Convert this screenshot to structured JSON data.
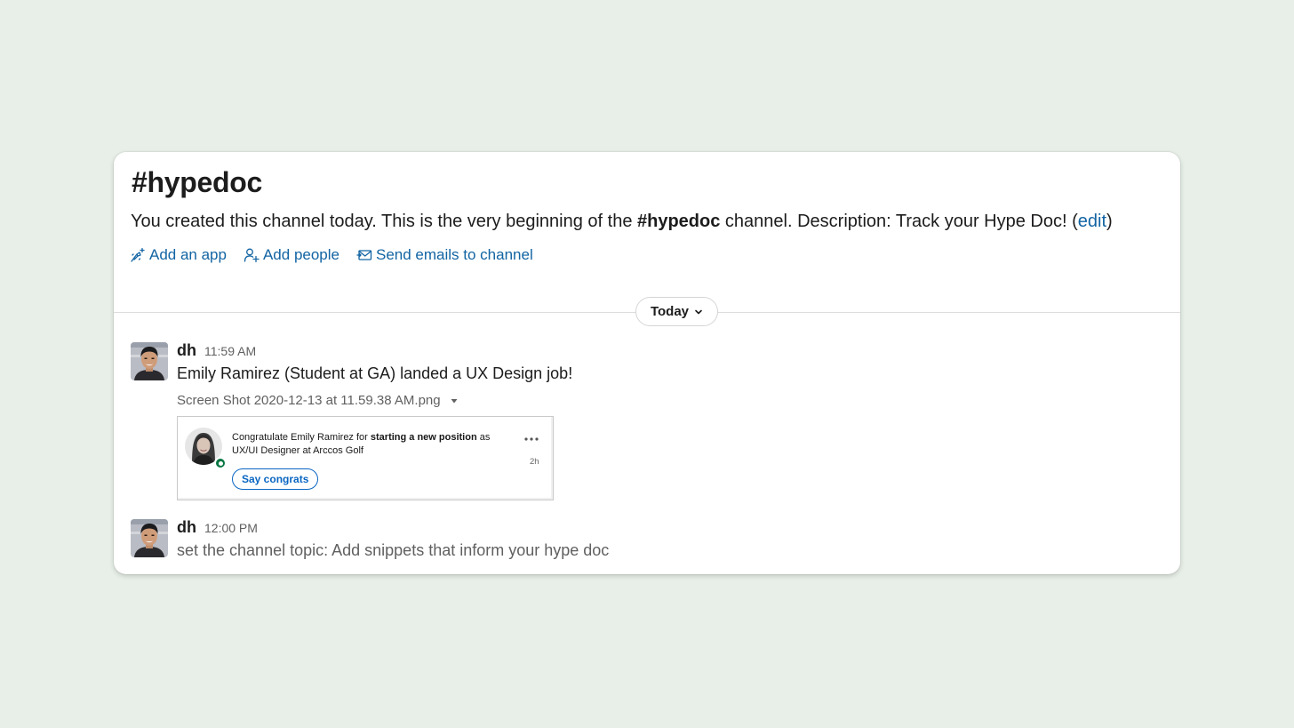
{
  "channel": {
    "title_hash": "#",
    "title_name": "hypedoc",
    "intro_before": "You created this channel today. This is the very beginning of the ",
    "intro_channel": "#hypedoc",
    "intro_after": " channel. Description: Track your Hype Doc! (",
    "intro_edit": "edit",
    "intro_close": ")"
  },
  "actions": [
    {
      "label": "Add an app",
      "icon": "add-app-icon"
    },
    {
      "label": "Add people",
      "icon": "add-person-icon"
    },
    {
      "label": "Send emails to channel",
      "icon": "email-icon"
    }
  ],
  "divider": {
    "label": "Today",
    "icon": "chevron-down-icon"
  },
  "messages": [
    {
      "author": "dh",
      "time": "11:59 AM",
      "text": "Emily Ramirez (Student at GA) landed a UX Design job!",
      "file": {
        "name": "Screen Shot 2020-12-13 at 11.59.38 AM.png",
        "preview": {
          "text_before": "Congratulate Emily Ramirez for ",
          "text_bold": "starting a new position",
          "text_after": " as UX/UI Designer at Arccos Golf",
          "time": "2h",
          "button": "Say congrats"
        }
      }
    },
    {
      "author": "dh",
      "time": "12:00 PM",
      "text": "set the channel topic: Add snippets that inform your hype doc"
    }
  ],
  "colors": {
    "background": "#e8efe8",
    "link": "#1264a3",
    "linkedin_blue": "#0a66c2",
    "online_green": "#057642"
  }
}
